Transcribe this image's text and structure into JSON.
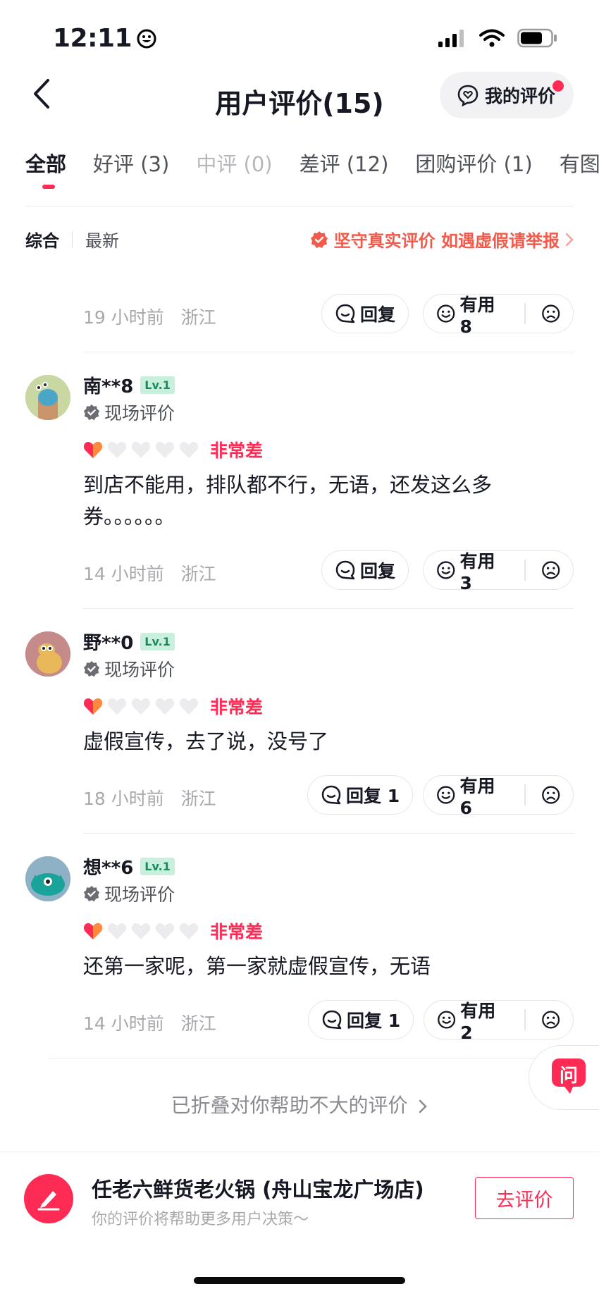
{
  "status_bar": {
    "time": "12:11"
  },
  "header": {
    "title": "用户评价(15)",
    "my_review_label": "我的评价"
  },
  "tabs": [
    {
      "label": "全部"
    },
    {
      "label": "好评 (3)"
    },
    {
      "label": "中评 (0)"
    },
    {
      "label": "差评 (12)"
    },
    {
      "label": "团购评价 (1)"
    },
    {
      "label": "有图 /"
    }
  ],
  "sort": {
    "option_1": "综合",
    "option_2": "最新"
  },
  "notice": "坚守真实评价 如遇虚假请举报",
  "top_partial": {
    "time": "19 小时前",
    "region": "浙江",
    "reply_label": "回复",
    "useful_label": "有用 8"
  },
  "reviews": [
    {
      "username": "南**8",
      "level": "Lv.1",
      "tag": "现场评价",
      "rating_text": "非常差",
      "stars": 1,
      "content_line1": "到店不能用，排队都不行，无语，还发这么多",
      "content_line2": "券。。。。。。",
      "time": "14 小时前",
      "region": "浙江",
      "reply_label": "回复",
      "useful_label": "有用 3"
    },
    {
      "username": "野**0",
      "level": "Lv.1",
      "tag": "现场评价",
      "rating_text": "非常差",
      "stars": 1,
      "content_line1": "虚假宣传，去了说，没号了",
      "time": "18 小时前",
      "region": "浙江",
      "reply_label": "回复 1",
      "useful_label": "有用 6"
    },
    {
      "username": "想**6",
      "level": "Lv.1",
      "tag": "现场评价",
      "rating_text": "非常差",
      "stars": 1,
      "content_line1": "还第一家呢，第一家就虚假宣传，无语",
      "time": "14 小时前",
      "region": "浙江",
      "reply_label": "回复 1",
      "useful_label": "有用 2"
    }
  ],
  "folded_label": "已折叠对你帮助不大的评价",
  "ask_label": "问",
  "bottom": {
    "shop_name": "任老六鲜货老火锅 (舟山宝龙广场店)",
    "subtitle": "你的评价将帮助更多用户决策～",
    "go_review_label": "去评价"
  },
  "colors": {
    "accent": "#fe2c55",
    "notice": "#f25b4c"
  }
}
